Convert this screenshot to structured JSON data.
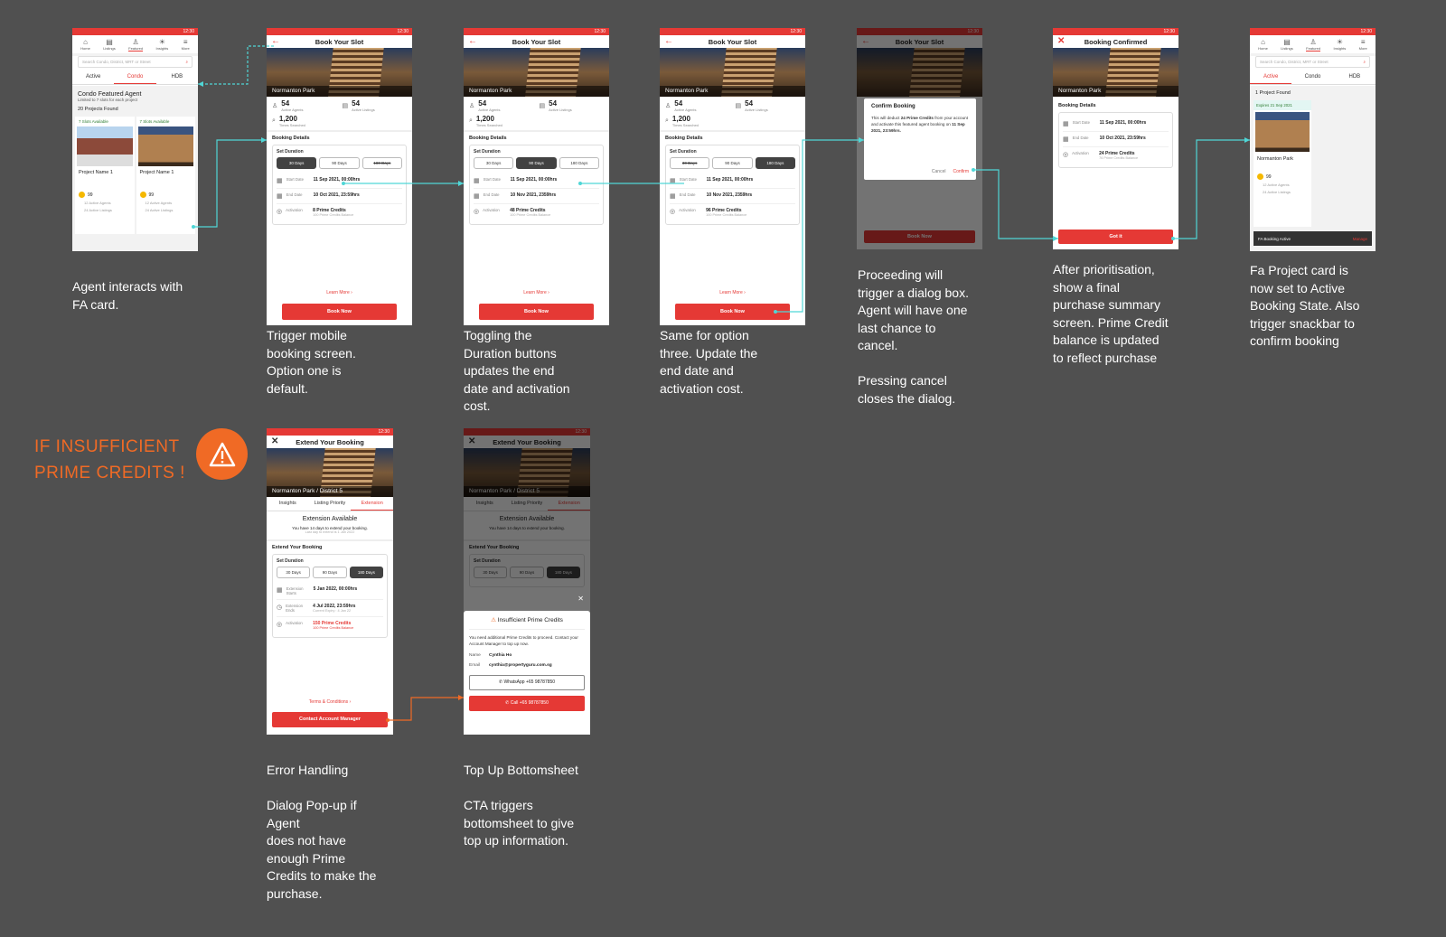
{
  "status_time": "12:30",
  "notes": {
    "n1": "Agent interacts with\nFA card.",
    "n2": "Trigger mobile\nbooking screen.\nOption one is\ndefault.",
    "n3": "Toggling the\nDuration buttons\nupdates the end\ndate and activation\ncost.",
    "n4": "Same for option\nthree. Update the\nend date and\nactivation cost.",
    "n5": "Proceeding will\ntrigger a dialog box.\nAgent will have one\nlast chance to\ncancel.\n\nPressing cancel\ncloses the dialog.",
    "n6": "After prioritisation,\nshow a final\npurchase summary\nscreen. Prime Credit\nbalance is updated\nto reflect purchase",
    "n7": "Fa Project card is\nnow set to Active\nBooking State. Also\ntrigger snackbar to\nconfirm booking",
    "n8": "Error Handling\n\nDialog Pop-up if\nAgent\ndoes not have\nenough Prime\nCredits to make the\npurchase.",
    "n9": "Top Up Bottomsheet\n\nCTA triggers\nbottomsheet to give\ntop up information."
  },
  "warning": {
    "line1": "IF INSUFFICIENT",
    "line2": "PRIME CREDITS !",
    "icon": "warning-icon"
  },
  "nav": [
    "Home",
    "Listings",
    "Featured",
    "Insights",
    "More"
  ],
  "search_placeholder": "Search Condo, District, MRT or Street",
  "tabs": [
    "Active",
    "Condo",
    "HDB"
  ],
  "list_screen": {
    "title": "Condo Featured Agent",
    "subtitle": "Limited to 7 slots for each project",
    "count": "20 Projects Found",
    "cards": [
      {
        "badge": "7 Slots Available",
        "name": "Project Name 1",
        "score": "99",
        "agents": "12 Active Agents",
        "listings": "24 Active Listings"
      },
      {
        "badge": "7 Slots Available",
        "name": "Project Name 1",
        "score": "99",
        "agents": "12 Active Agents",
        "listings": "24 Active Listings"
      }
    ]
  },
  "booking": {
    "title": "Book Your Slot",
    "hero": "Normanton Park",
    "agents_n": "54",
    "agents_l": "Active Agents",
    "listings_n": "54",
    "listings_l": "Active Listings",
    "searched_n": "1,200",
    "searched_l": "Times Searched",
    "details": "Booking Details",
    "set_duration": "Set Duration",
    "durations": [
      "30 Days",
      "90 Days",
      "180 Days"
    ],
    "start_k": "Start Date",
    "end_k": "End Date",
    "act_k": "Activation",
    "start_v": "11 Sep 2021, 00:00hrs",
    "end_v": [
      "10 Oct 2021, 23:59hrs",
      "10 Nov 2021, 2359hrs",
      "10 Nov 2021, 2359hrs"
    ],
    "act_v": [
      "8 Prime Credits",
      "48 Prime Credits",
      "96 Prime Credits"
    ],
    "balance": "100 Prime Credits Balance",
    "learn": "Learn More ›",
    "book": "Book Now"
  },
  "dialog": {
    "title": "Confirm Booking",
    "body1": "This will deduct ",
    "body_bold": "24 Prime Credits",
    "body2": " from your account and activate this featured agent booking on ",
    "body_date": "11 Sep 2021, 23:59hrs.",
    "cancel": "Cancel",
    "confirm": "Confirm"
  },
  "confirmed": {
    "title": "Booking Confirmed",
    "details": "Booking Details",
    "start": "11 Sep 2021, 00:00hrs",
    "end": "10 Oct 2021, 23:59hrs",
    "act": "24 Prime Credits",
    "balance": "76 Prime Credits Balance",
    "cta": "Got it"
  },
  "active_screen": {
    "count": "1 Project Found",
    "badge": "Expires 21 Sep 2021",
    "name": "Normanton Park",
    "score": "99",
    "agents": "12 Active Agents",
    "listings": "24 Active Listings",
    "snackbar": "FA Booking Active",
    "manage": "Manage"
  },
  "extend": {
    "title": "Extend Your Booking",
    "hero": "Normanton Park  /  District 5",
    "tabs": [
      "Insights",
      "Listing Priority",
      "Extension"
    ],
    "avail": "Extension Available",
    "avail_sub": "You have 14 days to extend your booking.",
    "avail_sub2": "Last day to extend is 1 Jan 2022",
    "section": "Extend Your Booking",
    "set_duration": "Set Duration",
    "durations": [
      "30 Days",
      "90 Days",
      "180 Days"
    ],
    "ext_start_k": "Extension Starts",
    "ext_start_v": "5 Jan 2022, 00:00hrs",
    "ext_end_k": "Extension Ends",
    "ext_end_v": "4 Jul 2022, 23:59hrs",
    "ext_end_sub": "Current Expiry : 4 Jan 22",
    "act_k": "Activation",
    "act_v": "150 Prime Credits",
    "act_sub": "100 Prime Credits Balance",
    "terms": "Terms & Conditions ›",
    "cta": "Contact Account Manager"
  },
  "topup": {
    "title": "Insufficient Prime Credits",
    "body": "You need additional Prime Credits to proceed. Contact your Account Manager to top up now.",
    "name_k": "Name",
    "name_v": "Cynthia Ho",
    "email_k": "Email",
    "email_v": "cynthia@propertyguru.com.sg",
    "whatsapp": "WhatsApp +65 98787850",
    "call": "Call +65 98787850"
  },
  "colors": {
    "bg": "#505050",
    "accent": "#e53935",
    "orange": "#f06a25",
    "link": "#4fd6d6"
  }
}
